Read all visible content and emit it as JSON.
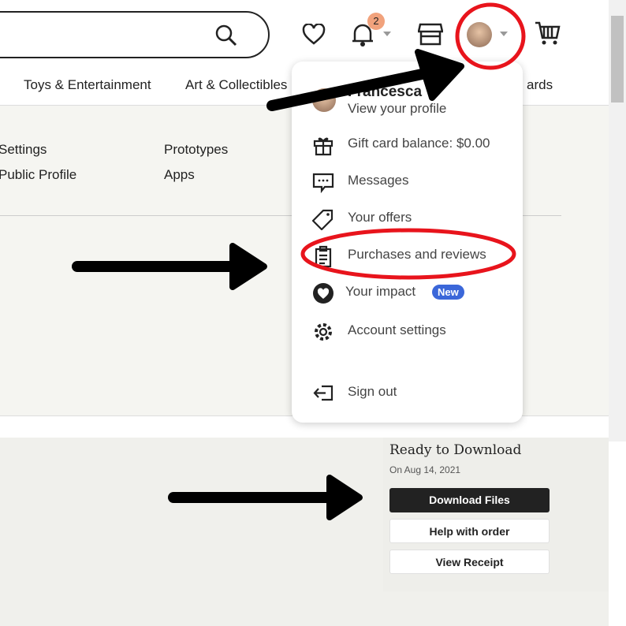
{
  "header": {
    "notification_count": "2"
  },
  "nav": {
    "items": [
      "Toys & Entertainment",
      "Art & Collectibles",
      "ards"
    ]
  },
  "settings_links": {
    "col1": [
      "Settings",
      "Public Profile"
    ],
    "col2": [
      "Prototypes",
      "Apps"
    ]
  },
  "menu": {
    "user_name": "Francesca",
    "view_profile": "View your profile",
    "items": [
      {
        "label": "Gift card balance: $0.00",
        "icon": "gift-icon"
      },
      {
        "label": "Messages",
        "icon": "message-icon"
      },
      {
        "label": "Your offers",
        "icon": "tag-icon"
      },
      {
        "label": "Purchases and reviews",
        "icon": "clipboard-icon"
      },
      {
        "label": "Your impact",
        "icon": "heart-icon",
        "badge": "New"
      },
      {
        "label": "Account settings",
        "icon": "gear-icon"
      },
      {
        "label": "Sign out",
        "icon": "sign-out-icon"
      }
    ]
  },
  "order": {
    "status": "Ready to Download",
    "date": "On Aug 14, 2021",
    "download": "Download Files",
    "help": "Help with order",
    "receipt": "View Receipt"
  },
  "colors": {
    "annotation_red": "#e8141c",
    "badge_blue": "#3b67d9",
    "notif_orange": "#f1a27c"
  }
}
